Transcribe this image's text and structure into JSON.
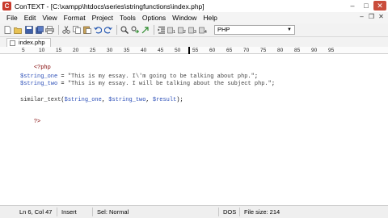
{
  "window": {
    "title": "ConTEXT - [C:\\xampp\\htdocs\\series\\stringfunctions\\index.php]",
    "minimize_glyph": "–",
    "maximize_glyph": "□",
    "close_glyph": "✕"
  },
  "menu": {
    "items": [
      "File",
      "Edit",
      "View",
      "Format",
      "Project",
      "Tools",
      "Options",
      "Window",
      "Help"
    ],
    "mdi_minimize_glyph": "–",
    "mdi_restore_glyph": "❐",
    "mdi_close_glyph": "✕"
  },
  "toolbar": {
    "language": "PHP",
    "icons": [
      "new-file-icon",
      "open-icon",
      "save-icon",
      "save-all-icon",
      "print-icon",
      "cut-icon",
      "copy-icon",
      "paste-icon",
      "undo-icon",
      "redo-icon",
      "find-icon",
      "replace-icon",
      "goto-icon",
      "indent-icon",
      "user-exec-1-icon",
      "user-exec-2-icon",
      "user-exec-3-icon",
      "user-exec-4-icon"
    ]
  },
  "tabs": [
    {
      "label": "index.php"
    }
  ],
  "ruler": {
    "marks": [
      "5",
      "10",
      "15",
      "20",
      "25",
      "30",
      "35",
      "40",
      "45",
      "50",
      "55",
      "60",
      "65",
      "70",
      "75",
      "80",
      "85",
      "90",
      "95"
    ]
  },
  "editor": {
    "lines": {
      "open_tag": "<?php",
      "line2_var": "$string_one",
      "line2_eq": " = ",
      "line2_str": "\"This is my essay. I\\'m going to be talking about php.\"",
      "line2_end": ";",
      "line3_var": "$string_two",
      "line3_eq": " = ",
      "line3_str": "\"This is my essay. I will be talking about the subject php.\"",
      "line3_end": ";",
      "line5_func": "similar_text",
      "line5_open": "(",
      "line5_arg1": "$string_one",
      "line5_comma1": ", ",
      "line5_arg2": "$string_two",
      "line5_comma2": ", ",
      "line5_arg3": "$result",
      "line5_close": ");",
      "close_tag": "?>"
    }
  },
  "status": {
    "position": "Ln 6, Col 47",
    "mode": "Insert",
    "selection": "Sel: Normal",
    "format": "DOS",
    "file_size": "File size: 214"
  },
  "colors": {
    "php_tag": "#800000",
    "variable": "#2c4fb8",
    "close_button": "#c94c3b"
  }
}
